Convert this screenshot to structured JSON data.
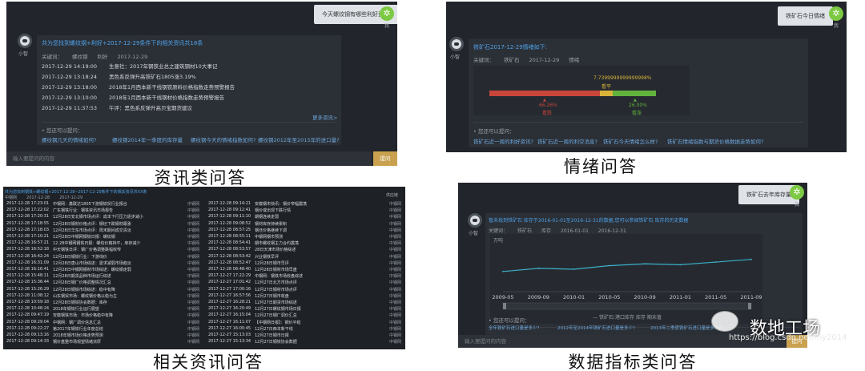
{
  "captions": {
    "news": "资讯类问答",
    "sentiment": "情绪问答",
    "related": "相关资讯问答",
    "indicator": "数据指标类问答"
  },
  "common": {
    "bot_name": "小智",
    "me": "我",
    "input_placeholder": "输入要提问的内容",
    "send": "提问",
    "also_ask": "• 您还可以提问：",
    "more": "更多资讯>"
  },
  "news": {
    "question": "今天螺纹钢有哪些利好资讯?",
    "title": "共为您找到螺纹钢+利好+2017-12-29条件下的相关资讯共18条",
    "meta": [
      "关键词：",
      "螺纹钢",
      "利好",
      "2017-12-29"
    ],
    "items": [
      {
        "time": "2017-12-29 14:19:00",
        "text": "生意社：2017年钢铁业总之建筑钢材10大事记"
      },
      {
        "time": "2017-12-29 13:18:24",
        "text": "黑色系反弹升高铁矿石1805涨3.19%"
      },
      {
        "time": "2017-12-29 13:18:00",
        "text": "2018年1月西本新干线钢铁原料价格指数走势预警报告"
      },
      {
        "time": "2017-12-29 13:10:00",
        "text": "2018年1月西本新干线钢材价格指数走势预警报告"
      },
      {
        "time": "2017-12-29 11:37:53",
        "text": "午评：黑色系反弹升高贝宝期货建议"
      }
    ],
    "suggestions": [
      "螺纹钢几天的情绪如何?",
      "螺纹钢2014年一季度的库存量",
      "螺纹钢今天的情绪指数如何?",
      "螺纹钢2012年至2015年的进口量?"
    ]
  },
  "sentiment": {
    "question": "铁矿石今日情绪",
    "title": "铁矿石2017-12-29情绪如下:",
    "meta": [
      "关键词：",
      "铁矿石",
      "2017-12-29",
      "情绪"
    ],
    "neutral_value": "7.7399999999999998%",
    "neutral_label": "看平",
    "bear_value": "66.26%",
    "bear_label": "看跌",
    "bull_value": "26.00%",
    "bull_label": "看涨",
    "bear_fraction": 0.6626,
    "neutral_fraction": 0.0774,
    "bull_fraction": 0.26,
    "suggestions": [
      "铁矿石近一周的利好资讯?",
      "铁矿石近一周的利空消息?",
      "铁矿石今天情绪怎么样?",
      "铁矿石情绪指数与期货价格数据走势如何?"
    ]
  },
  "related": {
    "title": "共为您找到钢铁+螺纹钢+2017-12-28~2017-12-29条件下的相关资讯共XX条",
    "meta": [
      "中钢网",
      "2017-12-28",
      "2017-12-29"
    ],
    "source_header": "供应链",
    "left_rows": [
      {
        "t": "2017-12-28 17:23:01",
        "x": "中钢网：鑫联达1805下游钢铁贸行业报合",
        "s": "中钢网"
      },
      {
        "t": "2017-12-28 17:22:02",
        "x": "广东钢铁行业：钢铁资讯市场报告",
        "s": "中钢网"
      },
      {
        "t": "2017-12-28 17:20:31",
        "x": "12月28日安北钢市场点评：成本下行压力逐步减小",
        "s": "中钢网"
      },
      {
        "t": "2017-12-28 17:18:55",
        "x": "12月28日钢材价格点评：钢坯下跌钢材跟涨",
        "s": "中钢网"
      },
      {
        "t": "2017-12-28 17:18:03",
        "x": "12月28日华东市场点评：周末期间成交清淡",
        "s": "中钢网"
      },
      {
        "t": "2017-12-28 17:10:21",
        "x": "12月28日中钢网钢铁日报：螺纹钢",
        "s": "中钢网"
      },
      {
        "t": "2017-12-28 16:57:21",
        "x": "12.28中钢网钢铁日报：螺纹价格持平，库存减少",
        "s": "中钢网"
      },
      {
        "t": "2017-12-28 16:52:18",
        "x": "中天钢铁日评：钢厂价格调整跌幅收窄",
        "s": "中钢网"
      },
      {
        "t": "2017-12-28 16:42:24",
        "x": "12月28日钢铁行业：下游询价",
        "s": "中钢网"
      },
      {
        "t": "2017-12-28 16:31:09",
        "x": "12月28日唐山市场综述：需求减弱市场趋淡",
        "s": "中钢网"
      },
      {
        "t": "2017-12-28 16:16:41",
        "x": "12月28日中钢网钢材市场综述：螺纹钢走弱",
        "s": "中钢网"
      },
      {
        "t": "2017-12-28 15:48:11",
        "x": "12月28日期货品种市场运行综述",
        "s": "中钢网"
      },
      {
        "t": "2017-12-28 15:36:44",
        "x": "12月28日钢厂价格调整情况汇总",
        "s": "中钢网"
      },
      {
        "t": "2017-12-28 15:26:29",
        "x": "12月28日钢铁市场综述：稳中有降",
        "s": "中钢网"
      },
      {
        "t": "2017-12-28 11:08:12",
        "x": "山东钢贸市场：螺纹钢价格以稳为主",
        "s": "中钢网"
      },
      {
        "t": "2017-12-28 10:59:18",
        "x": "12月28日钢铁协会数据：库存",
        "s": "中钢网"
      },
      {
        "t": "2017-12-28 10:48:24",
        "x": "2018年钢铁行业运行展望",
        "s": "中钢网"
      },
      {
        "t": "2017-12-28 09:47:19",
        "x": "安徽钢铁市场：市场价格稳中有降",
        "s": "中钢网"
      },
      {
        "t": "2017-12-28 09:29:04",
        "x": "中钢网：钢厂调价信息汇总",
        "s": "中钢网"
      },
      {
        "t": "2017-12-28 09:22:27",
        "x": "第2017年钢铁行业年度总结",
        "s": "中钢网"
      },
      {
        "t": "2017-12-28 09:13:16",
        "x": "2018年钢市场价格走势预测",
        "s": "中钢网"
      },
      {
        "t": "2017-12-28 09:14:33",
        "x": "钢价盘整市场观望情绪浓厚",
        "s": "中钢网"
      }
    ],
    "right_rows": [
      {
        "t": "2017-12-28 09:14:21",
        "x": "安徽钢市快讯：钢价窄幅震荡",
        "s": "中钢网"
      },
      {
        "t": "2017-12-28 09:12:41",
        "x": "钢价或出现下跌行情",
        "s": "中钢网"
      },
      {
        "t": "2017-12-28 09:11:10",
        "x": "期钢连续走弱",
        "s": "中钢网"
      },
      {
        "t": "2017-12-28 09:08:52",
        "x": "钢材库存持续累积",
        "s": "中钢网"
      },
      {
        "t": "2017-12-28 08:57:25",
        "x": "钢坯价格继续下调",
        "s": "中钢网"
      },
      {
        "t": "2017-12-28 08:55:11",
        "x": "中钢网钢市预测",
        "s": "中钢网"
      },
      {
        "t": "2017-12-28 08:54:41",
        "x": "期市螺纹钢主力合约震荡",
        "s": "中钢网"
      },
      {
        "t": "2017-12-28 08:53:57",
        "x": "28日天津市场价格综述",
        "s": "中钢网"
      },
      {
        "t": "2017-12-28 08:53:42",
        "x": "兴业钢铁早评",
        "s": "中钢网"
      },
      {
        "t": "2017-12-28 08:52:47",
        "x": "12月28日钢市早评",
        "s": "中钢网"
      },
      {
        "t": "2017-12-28 08:48:40",
        "x": "12月28日钢材市场早盘",
        "s": "中钢网"
      },
      {
        "t": "2017-12-27 17:22:29",
        "x": "中钢网：钢铁市场收盘综述",
        "s": "中钢网"
      },
      {
        "t": "2017-12-27 17:01:42",
        "x": "12月27日北方市场点评",
        "s": "中钢网"
      },
      {
        "t": "2017-12-27 17:00:16",
        "x": "12月27日钢材市场点评",
        "s": "中钢网"
      },
      {
        "t": "2017-12-27 16:57:56",
        "x": "12月27日钢市收盘",
        "s": "中钢网"
      },
      {
        "t": "2017-12-27 16:28:21",
        "x": "12月27日期货市场综述",
        "s": "中钢网"
      },
      {
        "t": "2017-12-27 16:20:49",
        "x": "12月27日螺纹钢市场日报",
        "s": "中钢网"
      },
      {
        "t": "2017-12-27 16:15:04",
        "x": "12月27日钢厂调价汇总",
        "s": "中钢网"
      },
      {
        "t": "2017-12-27 16:11:07",
        "x": "【中钢网日报】：钢价平稳",
        "s": "中钢网"
      },
      {
        "t": "2017-12-27 16:00:45",
        "x": "12月27日西本新干线",
        "s": "中钢网"
      },
      {
        "t": "2017-12-27 15:13:03",
        "x": "12月27日钢市日报",
        "s": "中钢网"
      },
      {
        "t": "2017-12-27 15:13:34",
        "x": "12月27日钢铁协会数据",
        "s": "中钢网"
      }
    ]
  },
  "indicator": {
    "question": "铁矿石去年库存量",
    "title": "暂未找到铁矿石 库存于2016-01-01至2016-12-31的数据,您可以参阅铁矿石 库存的历史数据",
    "meta": [
      "关键词：",
      "铁矿石",
      "库存",
      "2016-01-01",
      "2016-12-31"
    ],
    "legend": "— 铁矿石:港口库存 库存 期末值",
    "suggestions": [
      "全年铁矿石进口量是多少?",
      "2012年至2014年铁矿石进口量是多少?",
      "2013年二季度铁矿石进口量是多少?"
    ]
  },
  "chart_data": {
    "type": "line",
    "title": "",
    "ylabel": "万吨",
    "xlabel": "",
    "x": [
      "2009-05",
      "2009-09",
      "2010-01",
      "2010-05",
      "2010-09",
      "2011-01",
      "2011-05",
      "2011-09"
    ],
    "series": [
      {
        "name": "铁矿石:港口库存",
        "values": [
          0.45,
          0.52,
          0.5,
          0.58,
          0.62,
          0.6,
          0.66,
          0.72
        ]
      }
    ],
    "ylim": [
      0,
      1
    ],
    "grid": false,
    "legend": "bottom"
  },
  "watermark": {
    "brand": "数地工场",
    "url": "https://blog.csdn.net/lhy2014"
  },
  "colors": {
    "panel": "#22252b",
    "accent": "#4fa3ea",
    "bear": "#c7453a",
    "neutral": "#d9b23a",
    "bull": "#62b23d",
    "send": "#c9a14f"
  }
}
